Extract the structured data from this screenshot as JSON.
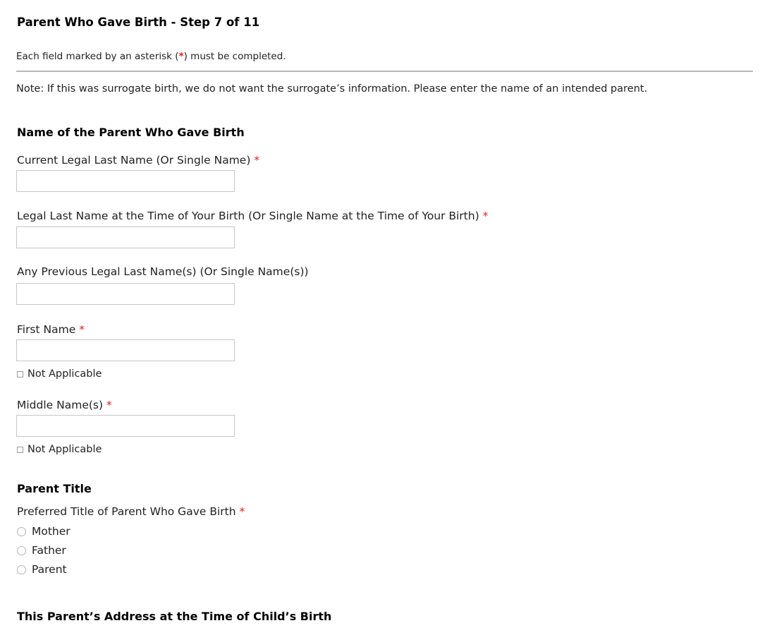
{
  "header": {
    "title": "Parent Who Gave Birth - Step 7 of 11",
    "required_note_before": "Each field marked by an asterisk (",
    "required_note_asterisk": "*",
    "required_note_after": ") must be completed."
  },
  "note": "Note: If this was surrogate birth, we do not want the surrogate’s information. Please enter the name of an intended parent.",
  "name_section": {
    "heading": "Name of the Parent Who Gave Birth",
    "fields": [
      {
        "label": "Current Legal Last Name (Or Single Name)",
        "required": "*",
        "value": ""
      },
      {
        "label": "Legal Last Name at the Time of Your Birth (Or Single Name at the Time of Your Birth)",
        "required": "*",
        "value": ""
      },
      {
        "label": "Any Previous Legal Last Name(s) (Or Single Name(s))",
        "required": "",
        "value": ""
      },
      {
        "label": "First Name",
        "required": "*",
        "value": "",
        "not_applicable_label": "Not Applicable",
        "not_applicable_checked": false
      },
      {
        "label": "Middle Name(s)",
        "required": "*",
        "value": "",
        "not_applicable_label": "Not Applicable",
        "not_applicable_checked": false
      }
    ]
  },
  "title_section": {
    "heading": "Parent Title",
    "question": "Preferred Title of Parent Who Gave Birth",
    "required": "*",
    "options": [
      {
        "label": "Mother",
        "selected": false
      },
      {
        "label": "Father",
        "selected": false
      },
      {
        "label": "Parent",
        "selected": false
      }
    ]
  },
  "address_section": {
    "heading": "This Parent’s Address at the Time of Child’s Birth"
  },
  "colors": {
    "required_asterisk": "#e0201d",
    "divider": "#b8b8b8",
    "input_border": "#c6c6c6"
  }
}
